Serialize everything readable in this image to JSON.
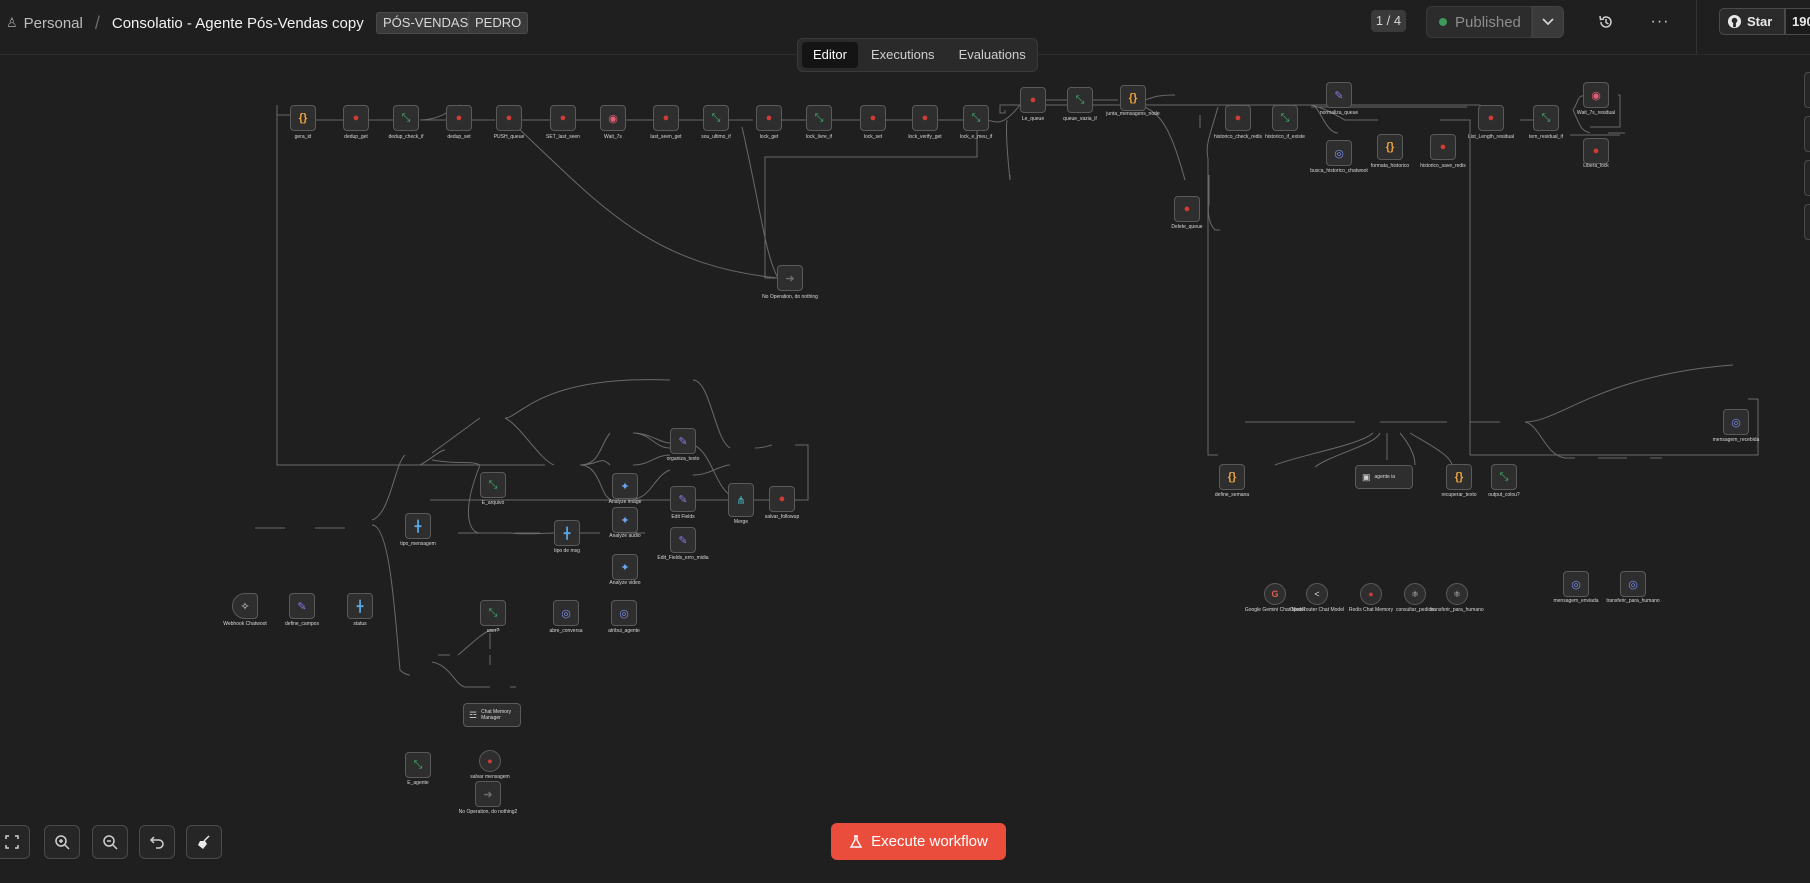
{
  "header": {
    "breadcrumb_owner": "Personal",
    "breadcrumb_separator": "/",
    "workflow_title": "Consolatio - Agente Pós-Vendas copy",
    "tags": [
      "PÓS-VENDAS",
      "PEDRO"
    ],
    "version_badge": "1 / 4",
    "publish_status": "Published",
    "github_star_label": "Star",
    "github_star_count": "190,"
  },
  "tabs": [
    {
      "label": "Editor",
      "active": true
    },
    {
      "label": "Executions",
      "active": false
    },
    {
      "label": "Evaluations",
      "active": false
    }
  ],
  "nodes": {
    "gera_id": "gera_id",
    "dedup_get": "dedup_get",
    "dedup_check_if": "dedup_check_if",
    "dedup_set": "dedup_set",
    "push_queue": "PUSH_queue",
    "set_last_seen": "SET_last_seen",
    "wait": "Wait_7s",
    "last_seen_get": "last_seen_get",
    "sou_ultimo_if": "sou_ultimo_if",
    "lock_get": "lock_get",
    "lock_livre_if": "lock_livre_if",
    "lock_set": "lock_set",
    "lock_verify_get": "lock_verify_get",
    "lock_e_meu_if": "lock_e_meu_if",
    "le_queue": "Le_queue",
    "queue_vazia_if": "queue_vazia_if",
    "junta_mensagens": "junta_mensagens_node",
    "delete_queue": "Delete_queue",
    "noop1": "No Operation, do nothing",
    "historico_check": "historico_check_redis",
    "historico_if_existe": "historico_if_existe",
    "normaliza_queue": "normaliza_queue",
    "busca_historico": "busca_historico_chatwoot",
    "formata_historico": "formata_historico",
    "historico_save": "historico_save_redis",
    "list_length": "List_Length_residual",
    "tem_residual_if": "tem_residual_if",
    "wait_residual": "Wait_7s_residual",
    "libera_lock": "Libera_lock",
    "mensagem_recebida": "mensagem_recebida",
    "define_semana": "define_semana",
    "agente_ia": "agente ia",
    "recuperar_texto": "recuperar_texto",
    "output_colou": "output_colou?",
    "google_gemini": "Google Gemini Chat Model",
    "openrouter": "OpenRouter Chat Model",
    "redis_memory": "Redis Chat Memory",
    "consultar_pedido": "consultar_pedido",
    "transferir": "transferir_para_humano",
    "mensagem_enviada": "mensagem_enviada",
    "transferir2": "transferir_para_humano",
    "webhook": "Webhook Chatwoot",
    "define_campos": "define_campos",
    "status": "status",
    "tipo_mensagem": "tipo_mensagem",
    "e_arquivo": "E_arquivo",
    "tipo_msg": "tipo de msg",
    "analyze_image": "Analyze image",
    "analyze_audio": "Analyze audio",
    "analyze_video": "Analyze video",
    "organiza_texto": "organiza_texto",
    "edit_fields": "Edit Fields",
    "edit_fields_erro": "Edit_Fields_erro_midia",
    "merge": "Merge",
    "salvar_followup": "salvar_followup",
    "user": "user?",
    "abre_conversa": "abre_conversa",
    "atribui_agente": "atribui_agente",
    "e_agente": "E_agente",
    "chat_memory_manager": "Chat Memory Manager",
    "salvar_mensagem": "salvar mensagem",
    "noop2": "No Operation, do nothing2"
  },
  "controls": {
    "execute_label": "Execute workflow"
  },
  "colors": {
    "accent": "#eb4d3d",
    "canvas_bg": "#1f1f1f",
    "node_bg": "#2e2e2e",
    "if_icon": "#3fb36b",
    "redis_icon": "#d23b35",
    "code_icon": "#f0a33a",
    "edit_icon": "#8b7ae8",
    "http_icon": "#7b8ff0",
    "published_dot": "#3d9a5a"
  }
}
